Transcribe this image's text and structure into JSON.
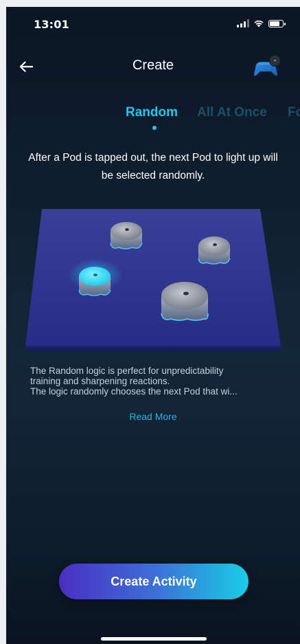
{
  "status_bar": {
    "time": "13:01",
    "signal_icon": "cellular-signal-icon",
    "wifi_icon": "wifi-icon",
    "battery_icon": "battery-icon"
  },
  "header": {
    "back_icon": "arrow-left-icon",
    "title": "Create",
    "controller_icon": "game-controller-icon",
    "controller_badge": "-"
  },
  "tabs": [
    {
      "label": "Random",
      "active": true
    },
    {
      "label": "All At Once",
      "active": false
    },
    {
      "label": "Fo",
      "active": false
    }
  ],
  "description": "After a Pod is tapped out, the next Pod to light up will be selected randomly.",
  "illustration": {
    "pods_total": 4,
    "pods_lit": 1,
    "lit_color": "#1fd2f0"
  },
  "body": {
    "lines": [
      "The Random logic is perfect for unpredictability",
      "training and sharpening reactions.",
      "The logic randomly chooses the next Pod that wi..."
    ],
    "read_more": "Read More"
  },
  "cta": {
    "label": "Create Activity"
  },
  "colors": {
    "accent": "#1fc8ee",
    "inactive_tab": "#1d4e68",
    "background": "#0f1d2d",
    "cta_start": "#4a2fc2",
    "cta_end": "#19cde6"
  }
}
